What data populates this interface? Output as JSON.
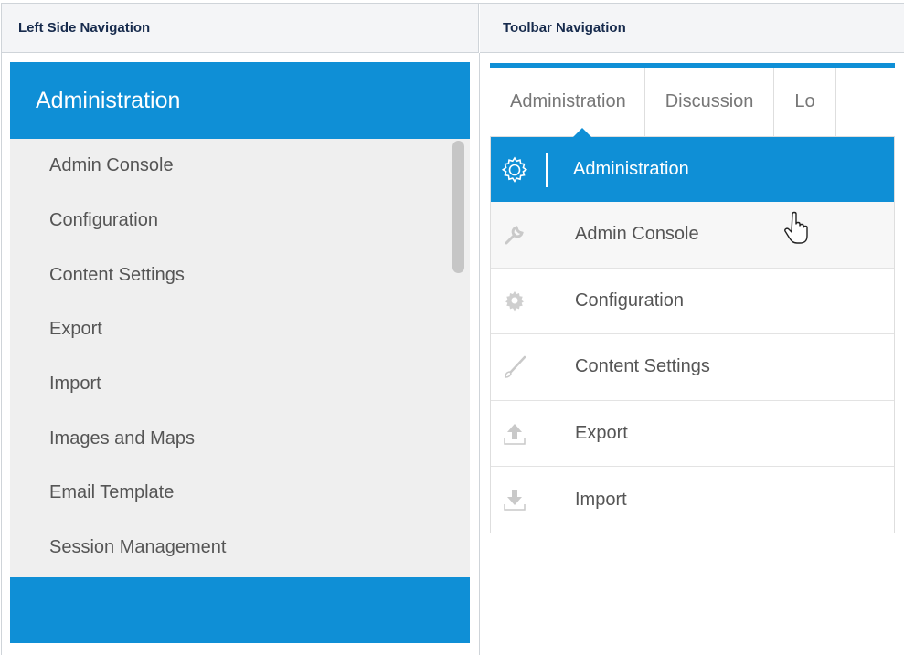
{
  "table": {
    "left_header": "Left Side Navigation",
    "right_header": "Toolbar Navigation"
  },
  "left_nav": {
    "title": "Administration",
    "items": [
      {
        "label": "Admin Console"
      },
      {
        "label": "Configuration"
      },
      {
        "label": "Content Settings"
      },
      {
        "label": "Export"
      },
      {
        "label": "Import"
      },
      {
        "label": "Images and Maps"
      },
      {
        "label": "Email Template"
      },
      {
        "label": "Session Management"
      }
    ]
  },
  "toolbar_nav": {
    "tabs": [
      {
        "label": "Administration"
      },
      {
        "label": "Discussion"
      },
      {
        "label": "Lo"
      }
    ],
    "menu_items": [
      {
        "label": "Administration",
        "icon": "gear-outline-icon"
      },
      {
        "label": "Admin Console",
        "icon": "wrench-icon"
      },
      {
        "label": "Configuration",
        "icon": "gear-icon"
      },
      {
        "label": "Content Settings",
        "icon": "brush-icon"
      },
      {
        "label": "Export",
        "icon": "upload-icon"
      },
      {
        "label": "Import",
        "icon": "download-icon"
      }
    ]
  },
  "colors": {
    "accent": "#0f8fd6",
    "nav_background": "#efefef"
  }
}
